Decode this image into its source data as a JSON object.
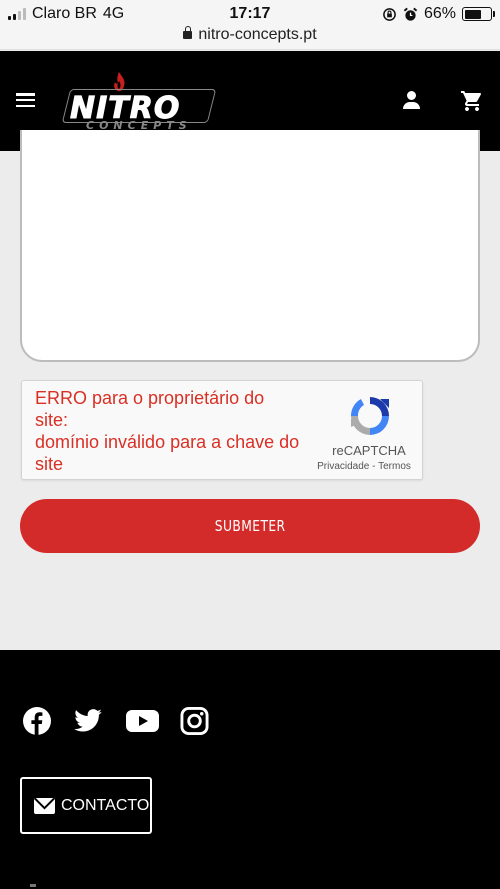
{
  "status_bar": {
    "carrier": "Claro BR",
    "network": "4G",
    "time": "17:17",
    "battery": "66%",
    "battery_level": 0.66,
    "url": "nitro-concepts.pt"
  },
  "header": {
    "logo_main": "NITRO",
    "logo_sub": "CONCEPTS",
    "menu_icon": "hamburger-menu-icon",
    "account_icon": "user-icon",
    "cart_icon": "shopping-cart-icon"
  },
  "captcha": {
    "error_text": "ERRO para o proprietário do site:\ndomínio inválido para a chave do site",
    "brand": "reCAPTCHA",
    "privacy": "Privacidade",
    "separator": "-",
    "terms": "Termos"
  },
  "form": {
    "submit_label": "SUBMETER"
  },
  "footer": {
    "social": [
      "facebook-icon",
      "twitter-icon",
      "youtube-icon",
      "instagram-icon"
    ],
    "contact_label": "CONTACTO"
  },
  "colors": {
    "accent": "#d32a2a",
    "error": "#d93025",
    "header_bg": "#000000",
    "page_bg": "#ececec"
  }
}
